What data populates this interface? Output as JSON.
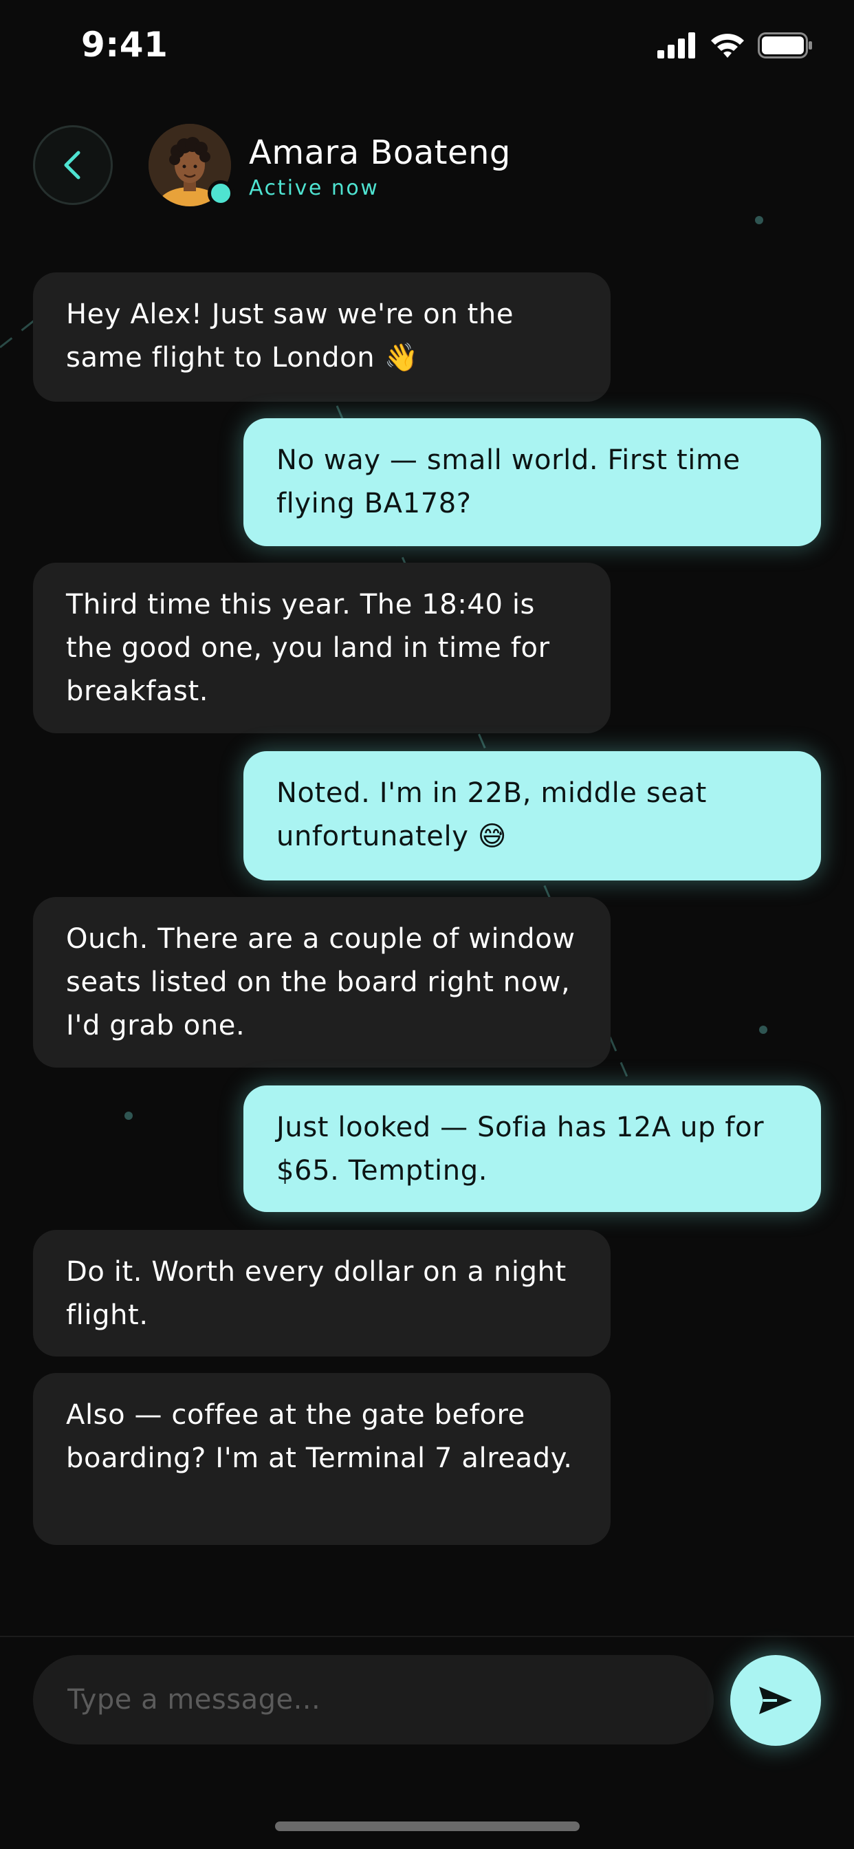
{
  "status_bar": {
    "time": "9:41"
  },
  "icons": {
    "signal": "cellular-signal-icon",
    "wifi": "wifi-icon",
    "battery": "battery-icon",
    "back": "chevron-left-icon",
    "send": "send-arrow-icon"
  },
  "colors": {
    "accent": "#4fe3d1",
    "outgoing_bubble": "#aaf4f2",
    "incoming_bubble": "#1f1f1f",
    "background": "#0b0b0b"
  },
  "contact": {
    "name": "Amara Boateng",
    "status": "Active now",
    "online": true
  },
  "messages": [
    {
      "direction": "in",
      "text": "Hey Alex! Just saw we're on the same flight to London 👋"
    },
    {
      "direction": "out",
      "text": "No way — small world. First time flying BA178?"
    },
    {
      "direction": "in",
      "text": "Third time this year. The 18:40 is the good one, you land in time for breakfast."
    },
    {
      "direction": "out",
      "text": "Noted. I'm in 22B, middle seat unfortunately 😅"
    },
    {
      "direction": "in",
      "text": "Ouch. There are a couple of window seats listed on the board right now, I'd grab one."
    },
    {
      "direction": "out",
      "text": "Just looked — Sofia has 12A up for $65. Tempting."
    },
    {
      "direction": "in",
      "text": "Do it. Worth every dollar on a night flight."
    },
    {
      "direction": "in",
      "text": "Also — coffee at the gate before boarding? I'm at Terminal 7 already."
    }
  ],
  "composer": {
    "placeholder": "Type a message...",
    "value": ""
  }
}
